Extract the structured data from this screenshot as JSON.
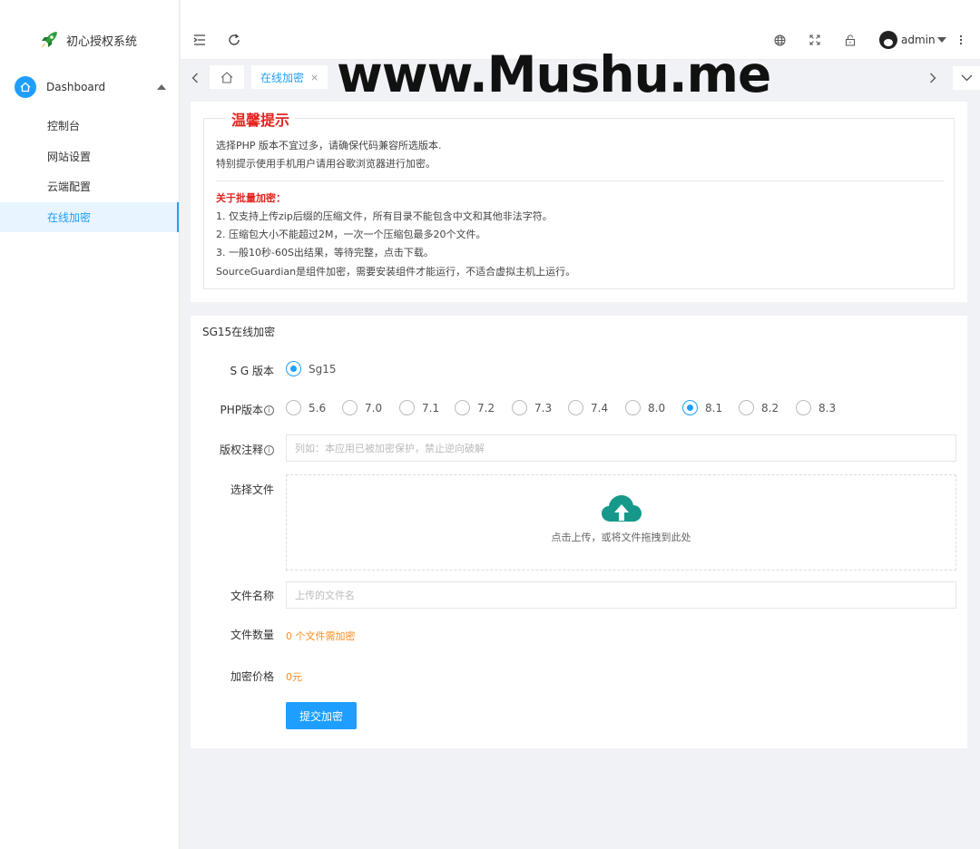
{
  "app": {
    "title": "初心授权系统"
  },
  "sidebar": {
    "group": {
      "label": "Dashboard",
      "icon": "home-icon"
    },
    "items": [
      {
        "label": "控制台"
      },
      {
        "label": "网站设置"
      },
      {
        "label": "云端配置"
      },
      {
        "label": "在线加密",
        "active": true
      }
    ]
  },
  "header": {
    "user": "admin",
    "icons": [
      "menu-fold-icon",
      "refresh-icon",
      "globe-icon",
      "fullscreen-icon",
      "lock-icon",
      "more-vertical-icon"
    ]
  },
  "tabs": {
    "active_label": "在线加密",
    "close_glyph": "×"
  },
  "watermark": "www.Mushu.me",
  "notice": {
    "title": "温馨提示",
    "lines": [
      "选择PHP 版本不宜过多，请确保代码兼容所选版本.",
      "特别提示使用手机用户请用谷歌浏览器进行加密。"
    ],
    "batch_heading": "关于批量加密：",
    "batch_lines": [
      "1. 仅支持上传zip后缀的压缩文件，所有目录不能包含中文和其他非法字符。",
      "2. 压缩包大小不能超过2M，一次一个压缩包最多20个文件。",
      "3. 一般10秒-60S出结果，等待完整，点击下载。",
      "SourceGuardian是组件加密，需要安装组件才能运行，不适合虚拟主机上运行。"
    ]
  },
  "form": {
    "title": "SG15在线加密",
    "sg_label": "S G 版本",
    "sg_option": "Sg15",
    "php_label": "PHP版本",
    "php_versions": [
      "5.6",
      "7.0",
      "7.1",
      "7.2",
      "7.3",
      "7.4",
      "8.0",
      "8.1",
      "8.2",
      "8.3"
    ],
    "php_selected": "8.1",
    "copyright_label": "版权注释",
    "copyright_placeholder": "列如：本应用已被加密保护，禁止逆向破解",
    "file_label": "选择文件",
    "upload_text": "点击上传，或将文件拖拽到此处",
    "filename_label": "文件名称",
    "filename_placeholder": "上传的文件名",
    "count_label": "文件数量",
    "count_value": "0 个文件需加密",
    "price_label": "加密价格",
    "price_value": "0元",
    "submit_label": "提交加密",
    "info_glyph": "i"
  },
  "colors": {
    "primary": "#1e9fff",
    "warning_red": "#e4231e",
    "orange": "#ff8c1a",
    "upload_icon": "#16998a"
  }
}
